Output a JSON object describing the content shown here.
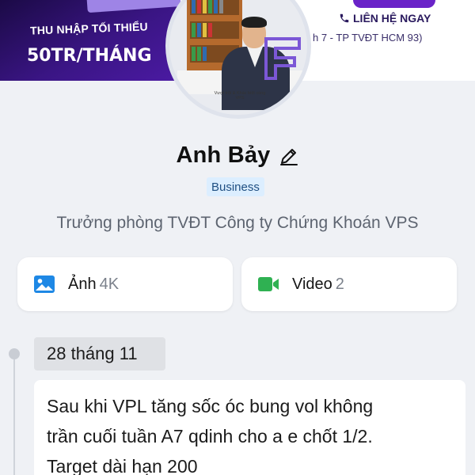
{
  "cover": {
    "tagline": "THU NHẬP TỐI THIỂU",
    "amount": "50TR/THÁNG",
    "contact_label": "LIÊN HỆ NGAY",
    "contact_sub": "h 7 - TP TVĐT HCM 93)"
  },
  "avatar": {
    "caption": "Vượt trội & Khác biệt cùng VPS"
  },
  "profile": {
    "name": "Anh Bảy",
    "badge": "Business",
    "title": "Trưởng phòng TVĐT Công ty Chứng Khoán VPS"
  },
  "media": {
    "photos_label": "Ảnh",
    "photos_count": "4K",
    "videos_label": "Video",
    "videos_count": "2"
  },
  "feed": {
    "date": "28 tháng 11",
    "post_text": "Sau khi VPL tăng sốc óc bung vol không\ntrần cuối tuần A7 qdinh cho a e chốt 1/2.\nTarget dài hạn 200"
  },
  "colors": {
    "badge_bg": "#dceeff",
    "photo_icon": "#1e88e5",
    "video_icon": "#2fb152",
    "promo_purple": "#3a1584"
  },
  "icons": {
    "edit": "pencil-icon",
    "phone": "phone-icon",
    "photos": "image-icon",
    "videos": "video-camera-icon"
  }
}
